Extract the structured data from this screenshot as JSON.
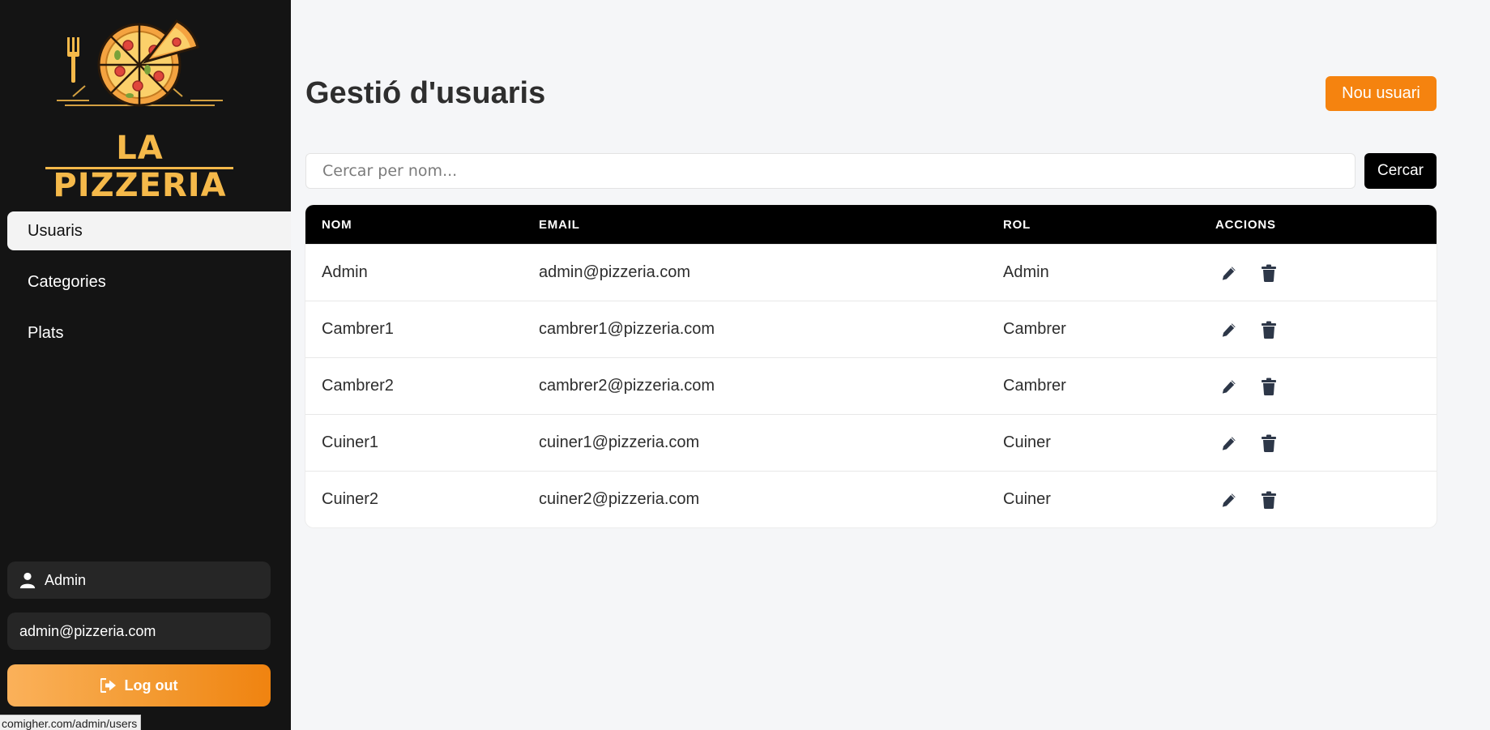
{
  "brand": {
    "name": "LA PIZZERIA"
  },
  "sidebar": {
    "items": [
      {
        "label": "Usuaris",
        "active": true
      },
      {
        "label": "Categories",
        "active": false
      },
      {
        "label": "Plats",
        "active": false
      }
    ],
    "user": {
      "name": "Admin",
      "email": "admin@pizzeria.com",
      "icon": "user-icon"
    },
    "logout": {
      "label": "Log out",
      "icon": "sign-out-icon"
    }
  },
  "status_bar": {
    "url": "comigher.com/admin/users"
  },
  "main": {
    "title": "Gestió d'usuaris",
    "new_button": "Nou usuari",
    "search": {
      "placeholder": "Cercar per nom...",
      "value": "",
      "button": "Cercar"
    },
    "table": {
      "headers": [
        "NOM",
        "EMAIL",
        "ROL",
        "ACCIONS"
      ],
      "rows": [
        {
          "name": "Admin",
          "email": "admin@pizzeria.com",
          "role": "Admin"
        },
        {
          "name": "Cambrer1",
          "email": "cambrer1@pizzeria.com",
          "role": "Cambrer"
        },
        {
          "name": "Cambrer2",
          "email": "cambrer2@pizzeria.com",
          "role": "Cambrer"
        },
        {
          "name": "Cuiner1",
          "email": "cuiner1@pizzeria.com",
          "role": "Cuiner"
        },
        {
          "name": "Cuiner2",
          "email": "cuiner2@pizzeria.com",
          "role": "Cuiner"
        }
      ],
      "actions": [
        "pencil-icon",
        "trash-icon"
      ]
    }
  },
  "colors": {
    "sidebar": "#141414",
    "accent": "#f5830f",
    "header": "#000000",
    "background": "#f5f6f8"
  }
}
